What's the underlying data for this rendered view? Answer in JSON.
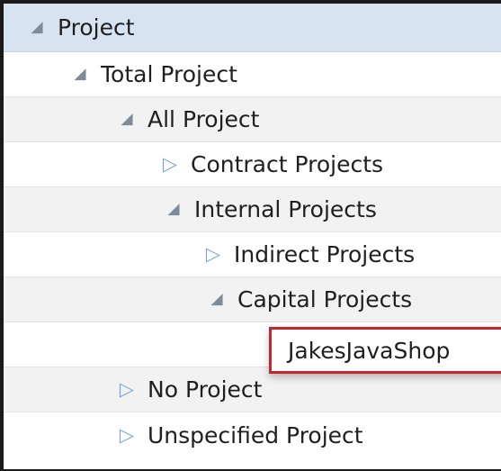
{
  "tree": {
    "rows": [
      {
        "label": "Project",
        "state": "expanded",
        "level": 0
      },
      {
        "label": "Total Project",
        "state": "expanded",
        "level": 1
      },
      {
        "label": "All Project",
        "state": "expanded",
        "level": 2
      },
      {
        "label": "Contract Projects",
        "state": "collapsed",
        "level": 3
      },
      {
        "label": "Internal Projects",
        "state": "expanded",
        "level": 3
      },
      {
        "label": "Indirect Projects",
        "state": "collapsed",
        "level": 4
      },
      {
        "label": "Capital Projects",
        "state": "expanded",
        "level": 4
      },
      {
        "label": "JakesJavaShop",
        "state": "leaf",
        "level": 5
      },
      {
        "label": "No Project",
        "state": "collapsed",
        "level": 2
      },
      {
        "label": "Unspecified Project",
        "state": "collapsed",
        "level": 2
      }
    ],
    "icons": {
      "expanded": "expanded-triangle-icon",
      "collapsed": "collapsed-triangle-icon"
    }
  },
  "colors": {
    "header_bg": "#d7e3f0",
    "highlight_border": "#c1272d",
    "expanded_icon": "#7f8b96",
    "collapsed_icon": "#7aa7d1"
  }
}
